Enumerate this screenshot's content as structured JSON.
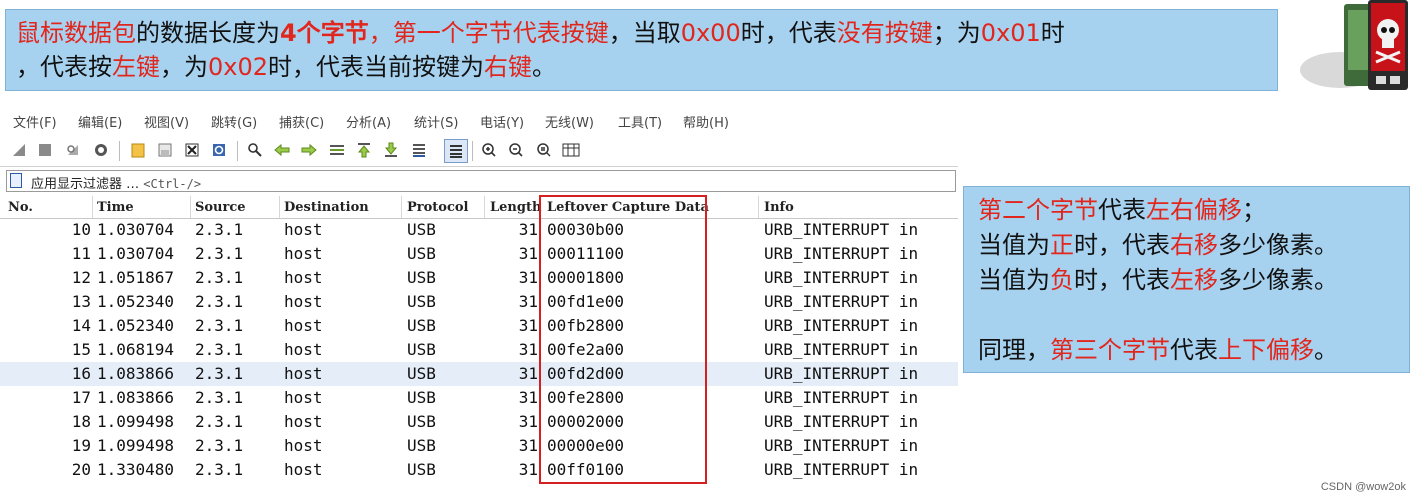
{
  "top_note": {
    "line1_parts": [
      {
        "text": "鼠标数据包",
        "style": "red"
      },
      {
        "text": "的数据长度为",
        "style": "plain"
      },
      {
        "text": "4个字节",
        "style": "redbold"
      },
      {
        "text": "，第一个字节代表按键",
        "style": "red"
      },
      {
        "text": "，当取",
        "style": "plain"
      },
      {
        "text": "0x00",
        "style": "red"
      },
      {
        "text": "时，代表",
        "style": "plain"
      },
      {
        "text": "没有按键",
        "style": "red"
      },
      {
        "text": "；为",
        "style": "plain"
      },
      {
        "text": "0x01",
        "style": "red"
      },
      {
        "text": "时",
        "style": "plain"
      }
    ],
    "line2_parts": [
      {
        "text": "，代表按",
        "style": "plain"
      },
      {
        "text": "左键",
        "style": "red"
      },
      {
        "text": "，为",
        "style": "plain"
      },
      {
        "text": "0x02",
        "style": "red"
      },
      {
        "text": "时，代表当前按键为",
        "style": "plain"
      },
      {
        "text": "右键",
        "style": "red"
      },
      {
        "text": "。",
        "style": "plain"
      }
    ]
  },
  "menu": [
    "文件(F)",
    "编辑(E)",
    "视图(V)",
    "跳转(G)",
    "捕获(C)",
    "分析(A)",
    "统计(S)",
    "电话(Y)",
    "无线(W)",
    "工具(T)",
    "帮助(H)"
  ],
  "filter": {
    "label": "应用显示过滤器 …",
    "shortcut": "<Ctrl-/>"
  },
  "columns": {
    "no": "No.",
    "time": "Time",
    "source": "Source",
    "destination": "Destination",
    "protocol": "Protocol",
    "length": "Length",
    "data": "Leftover Capture Data",
    "info": "Info"
  },
  "packets": [
    {
      "no": "10",
      "time": "1.030704",
      "source": "2.3.1",
      "destination": "host",
      "protocol": "USB",
      "length": "31",
      "data": "00030b00",
      "info": "URB_INTERRUPT in"
    },
    {
      "no": "11",
      "time": "1.030704",
      "source": "2.3.1",
      "destination": "host",
      "protocol": "USB",
      "length": "31",
      "data": "00011100",
      "info": "URB_INTERRUPT in"
    },
    {
      "no": "12",
      "time": "1.051867",
      "source": "2.3.1",
      "destination": "host",
      "protocol": "USB",
      "length": "31",
      "data": "00001800",
      "info": "URB_INTERRUPT in"
    },
    {
      "no": "13",
      "time": "1.052340",
      "source": "2.3.1",
      "destination": "host",
      "protocol": "USB",
      "length": "31",
      "data": "00fd1e00",
      "info": "URB_INTERRUPT in"
    },
    {
      "no": "14",
      "time": "1.052340",
      "source": "2.3.1",
      "destination": "host",
      "protocol": "USB",
      "length": "31",
      "data": "00fb2800",
      "info": "URB_INTERRUPT in"
    },
    {
      "no": "15",
      "time": "1.068194",
      "source": "2.3.1",
      "destination": "host",
      "protocol": "USB",
      "length": "31",
      "data": "00fe2a00",
      "info": "URB_INTERRUPT in"
    },
    {
      "no": "16",
      "time": "1.083866",
      "source": "2.3.1",
      "destination": "host",
      "protocol": "USB",
      "length": "31",
      "data": "00fd2d00",
      "info": "URB_INTERRUPT in"
    },
    {
      "no": "17",
      "time": "1.083866",
      "source": "2.3.1",
      "destination": "host",
      "protocol": "USB",
      "length": "31",
      "data": "00fe2800",
      "info": "URB_INTERRUPT in"
    },
    {
      "no": "18",
      "time": "1.099498",
      "source": "2.3.1",
      "destination": "host",
      "protocol": "USB",
      "length": "31",
      "data": "00002000",
      "info": "URB_INTERRUPT in"
    },
    {
      "no": "19",
      "time": "1.099498",
      "source": "2.3.1",
      "destination": "host",
      "protocol": "USB",
      "length": "31",
      "data": "00000e00",
      "info": "URB_INTERRUPT in"
    },
    {
      "no": "20",
      "time": "1.330480",
      "source": "2.3.1",
      "destination": "host",
      "protocol": "USB",
      "length": "31",
      "data": "00ff0100",
      "info": "URB_INTERRUPT in"
    }
  ],
  "selected_packet_no": "16",
  "side_note": {
    "line1_parts": [
      {
        "text": "第二个字节",
        "style": "red"
      },
      {
        "text": "代表",
        "style": "plain"
      },
      {
        "text": "左右偏移",
        "style": "red"
      },
      {
        "text": "；",
        "style": "plain"
      }
    ],
    "line2_parts": [
      {
        "text": "当值为",
        "style": "plain"
      },
      {
        "text": "正",
        "style": "red"
      },
      {
        "text": "时，代表",
        "style": "plain"
      },
      {
        "text": "右移",
        "style": "red"
      },
      {
        "text": "多少像素。",
        "style": "plain"
      }
    ],
    "line3_parts": [
      {
        "text": "当值为",
        "style": "plain"
      },
      {
        "text": "负",
        "style": "red"
      },
      {
        "text": "时，代表",
        "style": "plain"
      },
      {
        "text": "左移",
        "style": "red"
      },
      {
        "text": "多少像素。",
        "style": "plain"
      }
    ],
    "line4_parts": [
      {
        "text": "同理，",
        "style": "plain"
      },
      {
        "text": "第三个字节",
        "style": "red"
      },
      {
        "text": "代表",
        "style": "plain"
      },
      {
        "text": "上下偏移",
        "style": "red"
      },
      {
        "text": "。",
        "style": "plain"
      }
    ]
  },
  "watermark": "CSDN @wow2ok",
  "colors": {
    "note_bg": "#a7d2ef",
    "highlight_red": "#e0261d",
    "box_red": "#d42020",
    "selected_row": "#e5eef8"
  },
  "toolbar_icons": [
    "shark-fin-start-icon",
    "stop-icon",
    "restart-icon",
    "options-icon",
    "open-file-icon",
    "save-icon",
    "close-file-icon",
    "reload-icon",
    "find-icon",
    "back-icon",
    "forward-icon",
    "goto-packet-icon",
    "first-packet-icon",
    "last-packet-icon",
    "autoscroll-icon",
    "colorize-icon",
    "zoom-in-icon",
    "zoom-out-icon",
    "zoom-normal-icon",
    "resize-columns-icon"
  ]
}
